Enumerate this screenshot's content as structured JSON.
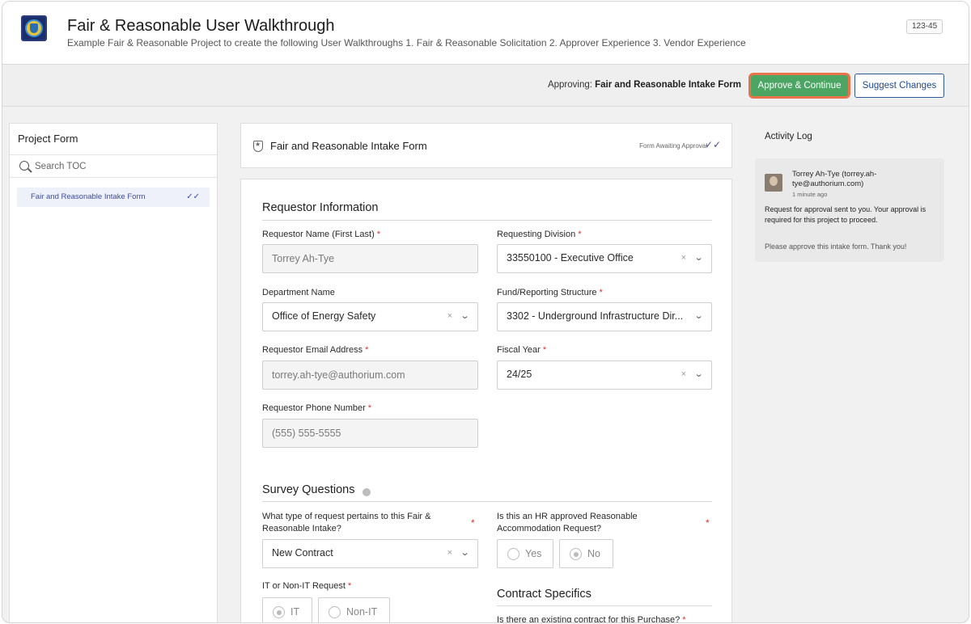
{
  "header": {
    "title": "Fair & Reasonable User Walkthrough",
    "description": "Example Fair & Reasonable Project to create the following User Walkthroughs 1. Fair & Reasonable Solicitation 2. Approver Experience 3. Vendor Experience",
    "project_number": "123-45"
  },
  "approval_bar": {
    "prefix": "Approving:",
    "form_name": "Fair and Reasonable Intake Form",
    "approve_label": "Approve & Continue",
    "suggest_label": "Suggest Changes",
    "approve_color": "#4da563",
    "highlight_color": "#e9734a"
  },
  "toc": {
    "title": "Project Form",
    "search_placeholder": "Search TOC",
    "items": [
      {
        "label": "Fair and Reasonable Intake Form",
        "check": "✓✓"
      }
    ]
  },
  "form_header": {
    "title": "Fair and Reasonable Intake Form",
    "status": "Form Awaiting Approval",
    "check": "✓✓"
  },
  "form": {
    "requestor_section": "Requestor Information",
    "requestor_name": {
      "label": "Requestor Name (First Last)",
      "value": "Torrey Ah-Tye",
      "required": "*"
    },
    "requesting_division": {
      "label": "Requesting Division",
      "value": "33550100 - Executive Office",
      "required": "*"
    },
    "department_name": {
      "label": "Department Name",
      "value": "Office of Energy Safety"
    },
    "fund_reporting": {
      "label": "Fund/Reporting Structure",
      "value": "3302 - Underground Infrastructure Dir...",
      "required": "*"
    },
    "requestor_email": {
      "label": "Requestor Email Address",
      "value": "torrey.ah-tye@authorium.com",
      "required": "*"
    },
    "fiscal_year": {
      "label": "Fiscal Year",
      "value": "24/25",
      "required": "*"
    },
    "requestor_phone": {
      "label": "Requestor Phone Number",
      "value": "(555) 555-5555",
      "required": "*"
    },
    "survey_section": "Survey Questions",
    "request_type": {
      "label": "What type of request pertains to this Fair & Reasonable Intake?",
      "value": "New Contract",
      "required": "*"
    },
    "hr_accommodation": {
      "label": "Is this an HR approved Reasonable Accommodation Request?",
      "options": [
        "Yes",
        "No"
      ],
      "selected": "No",
      "required": "*"
    },
    "it_request": {
      "label": "IT or Non-IT Request",
      "options": [
        "IT",
        "Non-IT"
      ],
      "selected": "IT",
      "required": "*"
    },
    "contract_section": "Contract Specifics",
    "existing_contract": {
      "label": "Is there an existing contract for this Purchase?",
      "required": "*"
    }
  },
  "activity": {
    "title": "Activity Log",
    "entry": {
      "name": "Torrey Ah-Tye (torrey.ah-tye@authorium.com)",
      "time": "1 minute ago",
      "message": "Request for approval sent to you. Your approval is required for this project to proceed.",
      "note": "Please approve this intake form. Thank you!"
    }
  },
  "icons": {
    "clear": "×",
    "chevron": "⌄"
  }
}
